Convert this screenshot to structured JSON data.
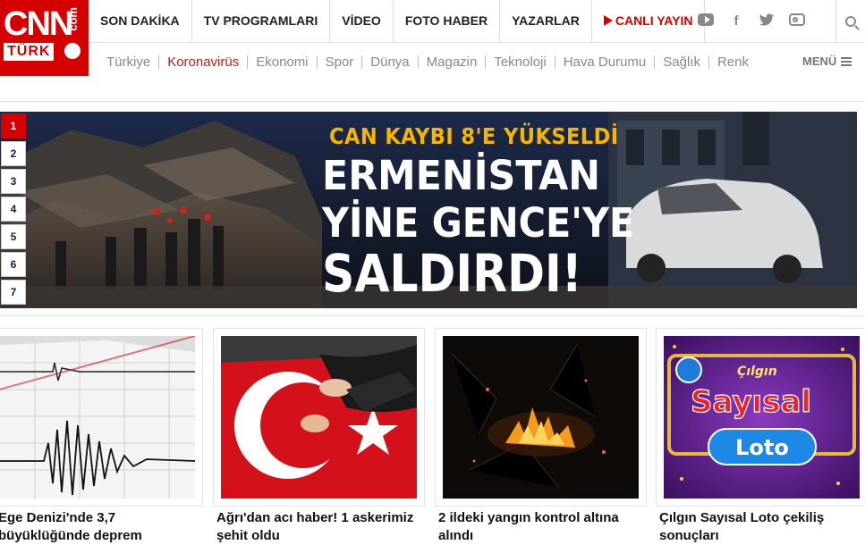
{
  "brand": {
    "name": "CNN",
    "domain": "com",
    "region": "TÜRK",
    "color": "#d50000"
  },
  "topnav": {
    "items": [
      "SON DAKİKA",
      "TV PROGRAMLARI",
      "VİDEO",
      "FOTO HABER",
      "YAZARLAR"
    ],
    "live": "CANLI YAYIN"
  },
  "social": [
    "youtube-icon",
    "facebook-icon",
    "twitter-icon",
    "instagram-icon"
  ],
  "subnav": {
    "items": [
      "Türkiye",
      "Koronavirüs",
      "Ekonomi",
      "Spor",
      "Dünya",
      "Magazin",
      "Teknoloji",
      "Hava Durumu",
      "Sağlık",
      "Renk"
    ],
    "active": "Koronavirüs",
    "menu_label": "MENÜ"
  },
  "hero": {
    "pages": [
      "1",
      "2",
      "3",
      "4",
      "5",
      "6",
      "7"
    ],
    "active_page": "1",
    "kicker": "CAN KAYBI 8'E YÜKSELDİ",
    "headline_1": "ERMENİSTAN",
    "headline_2": "YİNE GENCE'YE",
    "headline_3": "SALDIRDI!"
  },
  "cards": [
    {
      "title": "Ege Denizi'nde 3,7 büyüklüğünde deprem"
    },
    {
      "title": "Ağrı'dan acı haber! 1 askerimiz şehit oldu"
    },
    {
      "title": "2 ildeki yangın kontrol altına alındı"
    },
    {
      "title": "Çılgın Sayısal Loto çekiliş sonuçları"
    }
  ],
  "loto_logo": {
    "line1": "Çılgın",
    "line2": "Sayısal",
    "line3": "Loto"
  }
}
